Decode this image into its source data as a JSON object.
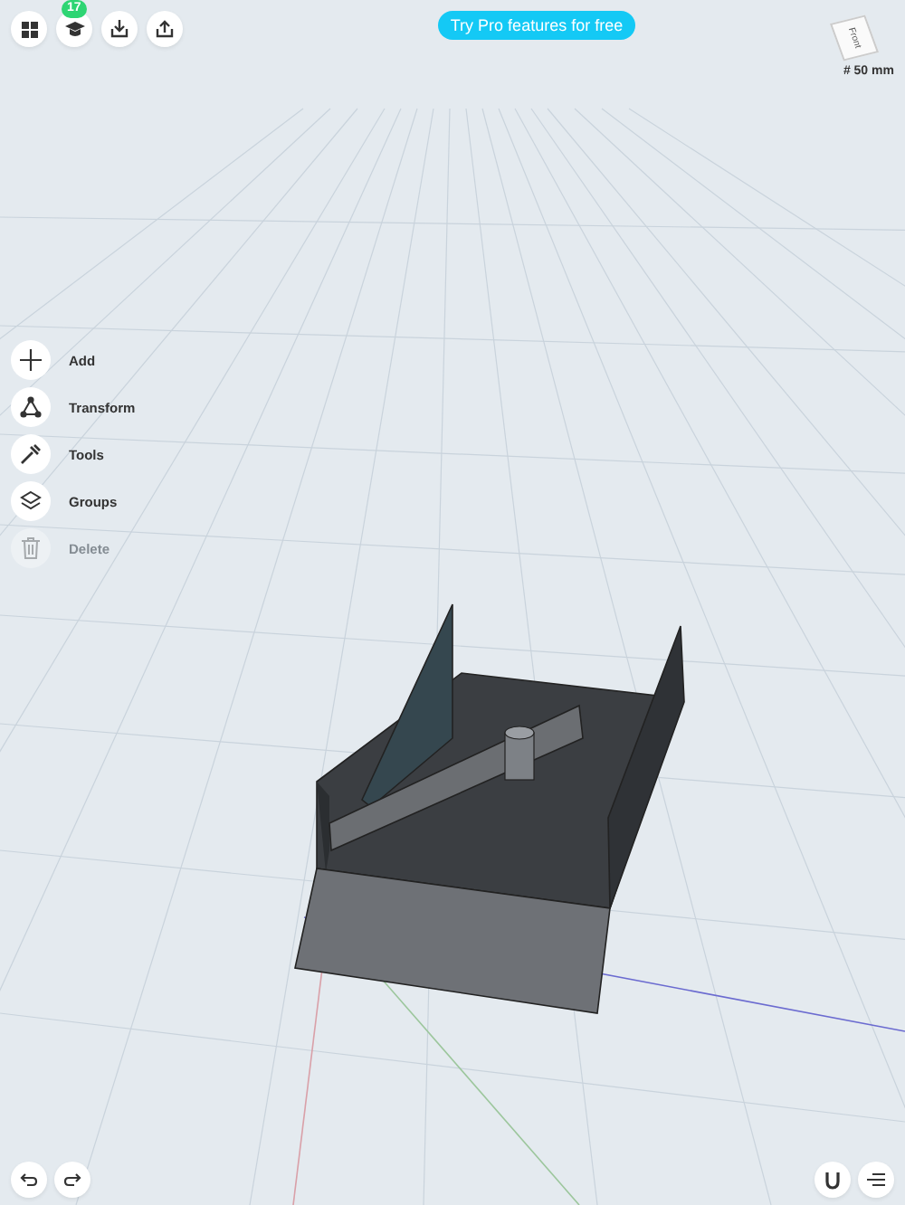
{
  "toolbar": {
    "badge": "17"
  },
  "promo": "Try Pro features for free",
  "view_cube": {
    "face": "Front",
    "scale": "# 50 mm"
  },
  "side_menu": [
    {
      "label": "Add",
      "kind": "plus",
      "disabled": false
    },
    {
      "label": "Transform",
      "kind": "transform",
      "disabled": false
    },
    {
      "label": "Tools",
      "kind": "tools",
      "disabled": false
    },
    {
      "label": "Groups",
      "kind": "layers",
      "disabled": false
    },
    {
      "label": "Delete",
      "kind": "trash",
      "disabled": true
    }
  ]
}
